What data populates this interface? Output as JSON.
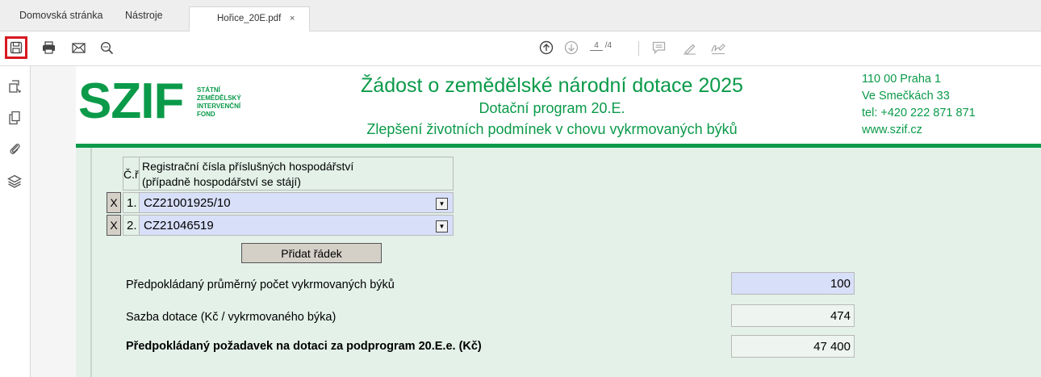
{
  "tabs": {
    "home": "Domovská stránka",
    "tools": "Nástroje",
    "document": "Hořice_20E.pdf",
    "close": "×"
  },
  "toolbar": {
    "page_current": "4",
    "page_total": "/4"
  },
  "header": {
    "logo": "SZIF",
    "logo_lines": [
      "STÁTNÍ",
      "ZEMĚDĚLSKÝ",
      "INTERVENČNÍ",
      "FOND"
    ],
    "title": "Žádost o zemědělské národní dotace 2025",
    "subtitle": "Dotační program 20.E.",
    "subsubtitle": "Zlepšení životních podmínek v chovu vykrmovaných býků",
    "contact": [
      "110 00 Praha 1",
      "Ve Smečkách 33",
      "tel: +420 222 871 871",
      "www.szif.cz"
    ]
  },
  "farms": {
    "col_no": "Č.ř.",
    "col_reg_line1": "Registrační čísla příslušných hospodářství",
    "col_reg_line2": "(případně hospodářství se stájí)",
    "rows": [
      {
        "x": "X",
        "no": "1.",
        "value": "CZ21001925/10"
      },
      {
        "x": "X",
        "no": "2.",
        "value": "CZ21046519"
      }
    ],
    "add_row": "Přidat řádek"
  },
  "fields": {
    "count_label": "Předpokládaný průměrný počet vykrmovaných býků",
    "count_value": "100",
    "rate_label": "Sazba dotace (Kč / vykrmovaného býka)",
    "rate_value": "474",
    "total_label": "Předpokládaný požadavek na dotaci za podprogram 20.E.e. (Kč)",
    "total_value": "47 400"
  },
  "colors": {
    "brand_green": "#0a9a49",
    "highlight_red": "#d71920",
    "field_blue": "#d8dff8",
    "form_bg": "#e3f1e9"
  },
  "icons": [
    "save-icon",
    "print-icon",
    "email-icon",
    "zoom-icon",
    "page-up-icon",
    "page-down-icon",
    "comment-icon",
    "highlight-pen-icon",
    "sign-icon",
    "page-thumbnails-icon",
    "copy-pages-icon",
    "attachment-icon",
    "layers-icon"
  ]
}
